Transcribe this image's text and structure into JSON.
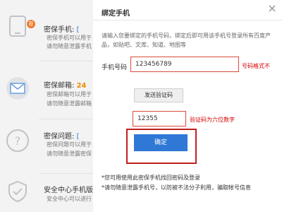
{
  "sidebar": {
    "items": [
      {
        "title": "密保手机:",
        "title_link": "[",
        "line1": "密保手机可以用于",
        "line2": "请勿随意泄露手机"
      },
      {
        "title": "密保邮箱:",
        "title_value": "24",
        "line1": "密保邮箱可以用于",
        "line2": "请勿随意泄露邮箱"
      },
      {
        "title": "密保问题:",
        "title_link": "[",
        "line1": "密保问题可以用于",
        "line2": "请勿随意泄露密保"
      },
      {
        "title": "安全中心手机版",
        "line1": "安全中心可以进行"
      }
    ],
    "badge": "荐"
  },
  "dialog": {
    "title": "绑定手机",
    "description": "请输入您要绑定的手机号码，绑定后即可用该手机号登录所有百度产品，如贴吧、文库、知道、地图等",
    "phone_label": "手机号码",
    "phone_value": "123456789",
    "phone_error": "号码格式不",
    "send_code_label": "发送验证码",
    "code_value": "12355",
    "code_error": "验证码为六位数字",
    "confirm_label": "确定",
    "note1": "*您可用使用此密保手机找回密码及登录",
    "note2": "*请勿随意泄露手机号，以防被不法分子利用，骗取帐号信息"
  },
  "colors": {
    "accent": "#2f78d6",
    "error": "#d40000",
    "highlight": "#c0201d",
    "badge": "#f0782a",
    "value_orange": "#f08a00"
  }
}
